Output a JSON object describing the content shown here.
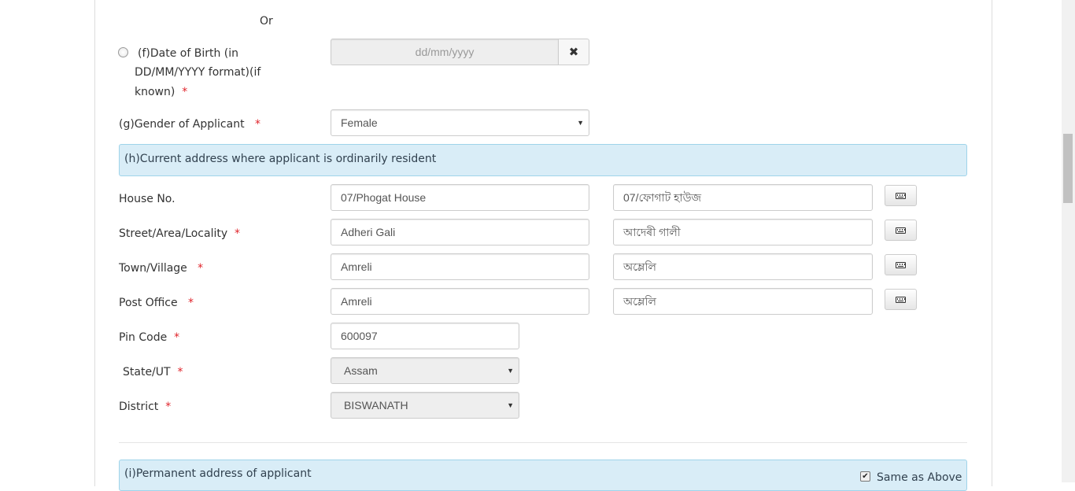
{
  "dob": {
    "or_text": "Or",
    "label_line1": "(f)Date of Birth (in",
    "label_line2": "DD/MM/YYYY format)(if",
    "label_line3": "known)",
    "placeholder": "dd/mm/yyyy",
    "clear_icon": "times-icon"
  },
  "gender": {
    "label": "(g)Gender of Applicant",
    "value": "Female"
  },
  "current_address": {
    "heading": "(h)Current address where applicant is ordinarily resident",
    "house": {
      "label": "House No.",
      "value": "07/Phogat House",
      "translit": "07/ফোগাট হাউজ"
    },
    "street": {
      "label": "Street/Area/Locality",
      "value": "Adheri Gali",
      "translit": "আদেৰী গালী"
    },
    "town": {
      "label": "Town/Village",
      "value": "Amreli",
      "translit": "অম্লেলি"
    },
    "post_office": {
      "label": "Post Office",
      "value": "Amreli",
      "translit": "অম্লেলি"
    },
    "pin": {
      "label": "Pin Code",
      "value": "600097"
    },
    "state": {
      "label": "State/UT",
      "value": "Assam"
    },
    "district": {
      "label": "District",
      "value": "BISWANATH"
    }
  },
  "permanent_address": {
    "heading": "(i)Permanent address of applicant",
    "same_as_above": "Same as Above",
    "same_as_above_checked": true
  },
  "required_mark": "*",
  "keyboard_icon": "keyboard-icon",
  "colors": {
    "section_bg": "#d9edf7",
    "section_border": "#9fd4ea",
    "required": "#e0242b",
    "disabled_bg": "#eeeeee"
  }
}
